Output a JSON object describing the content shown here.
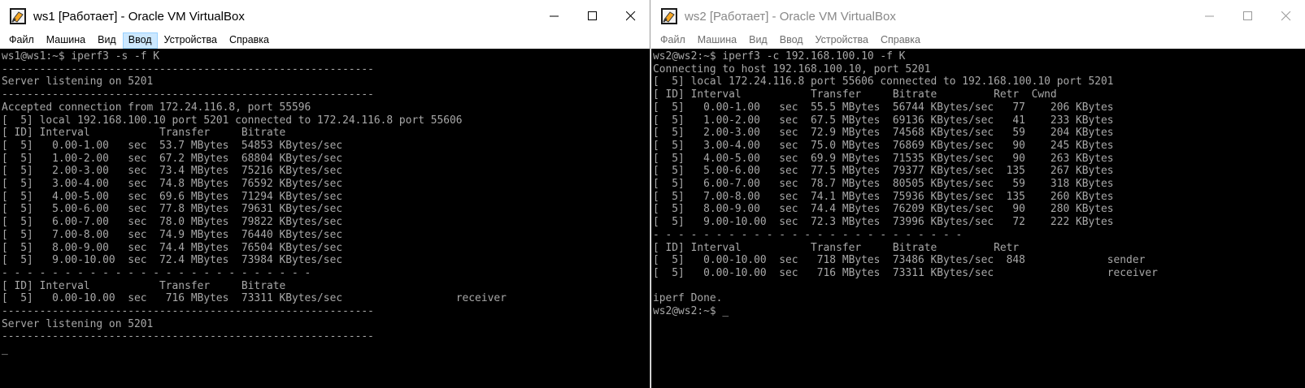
{
  "windows": [
    {
      "title": "ws1 [Работает] - Oracle VM VirtualBox",
      "menu": [
        "Файл",
        "Машина",
        "Вид",
        "Ввод",
        "Устройства",
        "Справка"
      ],
      "active_menu_index": 3,
      "terminal": "ws1@ws1:~$ iperf3 -s -f K\n-----------------------------------------------------------\nServer listening on 5201\n-----------------------------------------------------------\nAccepted connection from 172.24.116.8, port 55596\n[  5] local 192.168.100.10 port 5201 connected to 172.24.116.8 port 55606\n[ ID] Interval           Transfer     Bitrate\n[  5]   0.00-1.00   sec  53.7 MBytes  54853 KBytes/sec\n[  5]   1.00-2.00   sec  67.2 MBytes  68804 KBytes/sec\n[  5]   2.00-3.00   sec  73.4 MBytes  75216 KBytes/sec\n[  5]   3.00-4.00   sec  74.8 MBytes  76592 KBytes/sec\n[  5]   4.00-5.00   sec  69.6 MBytes  71294 KBytes/sec\n[  5]   5.00-6.00   sec  77.8 MBytes  79631 KBytes/sec\n[  5]   6.00-7.00   sec  78.0 MBytes  79822 KBytes/sec\n[  5]   7.00-8.00   sec  74.9 MBytes  76440 KBytes/sec\n[  5]   8.00-9.00   sec  74.4 MBytes  76504 KBytes/sec\n[  5]   9.00-10.00  sec  72.4 MBytes  73984 KBytes/sec\n- - - - - - - - - - - - - - - - - - - - - - - - -\n[ ID] Interval           Transfer     Bitrate\n[  5]   0.00-10.00  sec   716 MBytes  73311 KBytes/sec                  receiver\n-----------------------------------------------------------\nServer listening on 5201\n-----------------------------------------------------------\n",
      "cursor": "_"
    },
    {
      "title": "ws2 [Работает] - Oracle VM VirtualBox",
      "menu": [
        "Файл",
        "Машина",
        "Вид",
        "Ввод",
        "Устройства",
        "Справка"
      ],
      "terminal": "ws2@ws2:~$ iperf3 -c 192.168.100.10 -f K\nConnecting to host 192.168.100.10, port 5201\n[  5] local 172.24.116.8 port 55606 connected to 192.168.100.10 port 5201\n[ ID] Interval           Transfer     Bitrate         Retr  Cwnd\n[  5]   0.00-1.00   sec  55.5 MBytes  56744 KBytes/sec   77    206 KBytes\n[  5]   1.00-2.00   sec  67.5 MBytes  69136 KBytes/sec   41    233 KBytes\n[  5]   2.00-3.00   sec  72.9 MBytes  74568 KBytes/sec   59    204 KBytes\n[  5]   3.00-4.00   sec  75.0 MBytes  76869 KBytes/sec   90    245 KBytes\n[  5]   4.00-5.00   sec  69.9 MBytes  71535 KBytes/sec   90    263 KBytes\n[  5]   5.00-6.00   sec  77.5 MBytes  79377 KBytes/sec  135    267 KBytes\n[  5]   6.00-7.00   sec  78.7 MBytes  80505 KBytes/sec   59    318 KBytes\n[  5]   7.00-8.00   sec  74.1 MBytes  75936 KBytes/sec  135    260 KBytes\n[  5]   8.00-9.00   sec  74.4 MBytes  76209 KBytes/sec   90    280 KBytes\n[  5]   9.00-10.00  sec  72.3 MBytes  73996 KBytes/sec   72    222 KBytes\n- - - - - - - - - - - - - - - - - - - - - - - - -\n[ ID] Interval           Transfer     Bitrate         Retr\n[  5]   0.00-10.00  sec   718 MBytes  73486 KBytes/sec  848             sender\n[  5]   0.00-10.00  sec   716 MBytes  73311 KBytes/sec                  receiver\n\niperf Done.\nws2@ws2:~$ ",
      "cursor": "_"
    }
  ]
}
